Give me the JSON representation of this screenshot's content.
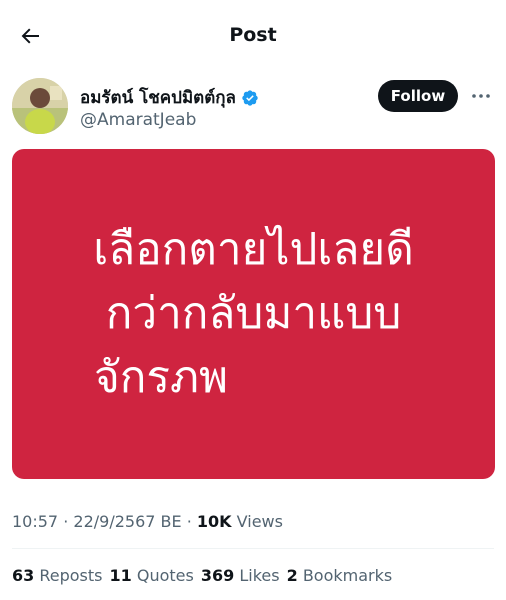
{
  "header": {
    "title": "Post"
  },
  "author": {
    "name": "อมรัตน์ โชคปมิตต์กุล",
    "handle": "@AmaratJeab",
    "follow_label": "Follow",
    "verified": true,
    "verified_color": "#1d9bf0"
  },
  "post": {
    "image_text": [
      "เลือกตายไปเลยดี",
      "กว่ากลับมาแบบ",
      "จักรภพ"
    ],
    "image_bg": "#cf2440"
  },
  "meta": {
    "time": "10:57",
    "date": "22/9/2567 BE",
    "separator": "·",
    "views_count": "10K",
    "views_label": "Views"
  },
  "stats": [
    {
      "count": "63",
      "label": "Reposts"
    },
    {
      "count": "11",
      "label": "Quotes"
    },
    {
      "count": "369",
      "label": "Likes"
    },
    {
      "count": "2",
      "label": "Bookmarks"
    }
  ]
}
